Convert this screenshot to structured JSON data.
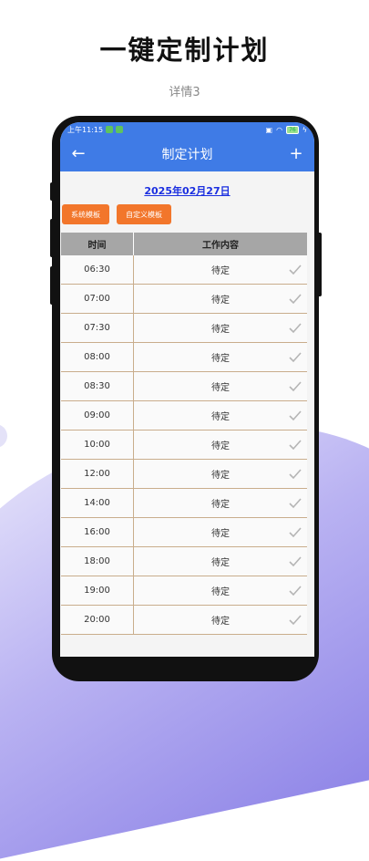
{
  "headline": "一键定制计划",
  "subline": "详情3",
  "status": {
    "time": "上午11:15",
    "battery": "76"
  },
  "appbar": {
    "back_icon": "←",
    "title": "制定计划",
    "add_icon": "+"
  },
  "date": "2025年02月27日",
  "buttons": {
    "system_template": "系统模板",
    "custom_template": "自定义模板"
  },
  "table": {
    "headers": [
      "时间",
      "工作内容"
    ],
    "rows": [
      {
        "time": "06:30",
        "task": "待定"
      },
      {
        "time": "07:00",
        "task": "待定"
      },
      {
        "time": "07:30",
        "task": "待定"
      },
      {
        "time": "08:00",
        "task": "待定"
      },
      {
        "time": "08:30",
        "task": "待定"
      },
      {
        "time": "09:00",
        "task": "待定"
      },
      {
        "time": "10:00",
        "task": "待定"
      },
      {
        "time": "12:00",
        "task": "待定"
      },
      {
        "time": "14:00",
        "task": "待定"
      },
      {
        "time": "16:00",
        "task": "待定"
      },
      {
        "time": "18:00",
        "task": "待定"
      },
      {
        "time": "19:00",
        "task": "待定"
      },
      {
        "time": "20:00",
        "task": "待定"
      }
    ]
  },
  "colors": {
    "accent": "#3f7be6",
    "button": "#f2762b",
    "date_link": "#1b2fe0"
  }
}
